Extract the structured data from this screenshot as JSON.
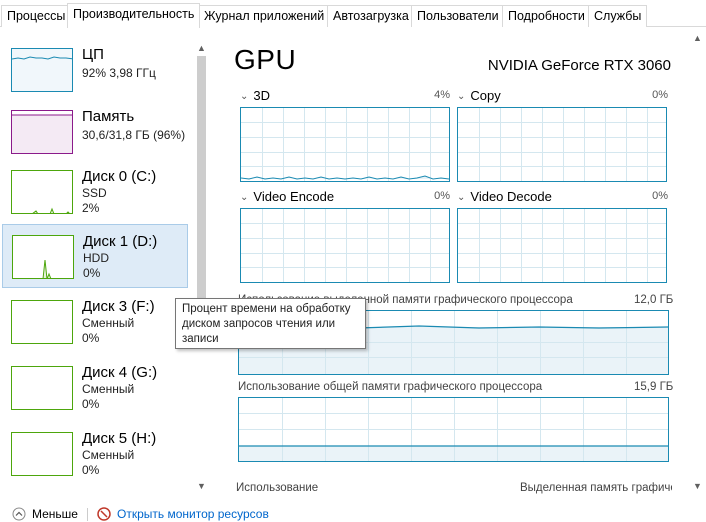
{
  "tabs": [
    {
      "label": "Процессы",
      "active": false
    },
    {
      "label": "Производительность",
      "active": true
    },
    {
      "label": "Журнал приложений",
      "active": false
    },
    {
      "label": "Автозагрузка",
      "active": false
    },
    {
      "label": "Пользователи",
      "active": false
    },
    {
      "label": "Подробности",
      "active": false
    },
    {
      "label": "Службы",
      "active": false
    }
  ],
  "sidebar": {
    "items": [
      {
        "name": "ЦП",
        "sub1": "92% 3,98 ГГц",
        "sub2": "",
        "color": "#1a8ab2"
      },
      {
        "name": "Память",
        "sub1": "30,6/31,8 ГБ (96%)",
        "sub2": "",
        "color": "#8b1a8b"
      },
      {
        "name": "Диск 0 (C:)",
        "sub1": "SSD",
        "sub2": "2%",
        "color": "#4da60c"
      },
      {
        "name": "Диск 1 (D:)",
        "sub1": "HDD",
        "sub2": "0%",
        "color": "#4da60c"
      },
      {
        "name": "Диск 3 (F:)",
        "sub1": "Сменный",
        "sub2": "0%",
        "color": "#4da60c"
      },
      {
        "name": "Диск 4 (G:)",
        "sub1": "Сменный",
        "sub2": "0%",
        "color": "#4da60c"
      },
      {
        "name": "Диск 5 (H:)",
        "sub1": "Сменный",
        "sub2": "0%",
        "color": "#4da60c"
      }
    ]
  },
  "main": {
    "title": "GPU",
    "gpu_name": "NVIDIA GeForce RTX 3060",
    "engines": [
      {
        "label": "3D",
        "value": "4%"
      },
      {
        "label": "Copy",
        "value": "0%"
      },
      {
        "label": "Video Encode",
        "value": "0%"
      },
      {
        "label": "Video Decode",
        "value": "0%"
      }
    ],
    "dedicated_label": "Использование выделенной памяти графического процессора",
    "dedicated_value": "12,0 ГБ",
    "shared_label": "Использование общей памяти графического процессора",
    "shared_value": "15,9 ГБ",
    "bottom_left": "Использование",
    "bottom_right": "Выделенная память графического процессора"
  },
  "tooltip": {
    "text": "Процент времени на обработку диском запросов чтения или записи"
  },
  "footer": {
    "less_label": "Меньше",
    "monitor_link": "Открыть монитор ресурсов"
  },
  "colors": {
    "gpu_accent": "#1a8ab2",
    "cpu": "#1a8ab2",
    "memory": "#8b1a8b",
    "disk": "#4da60c",
    "selected_bg": "#deebf7"
  }
}
